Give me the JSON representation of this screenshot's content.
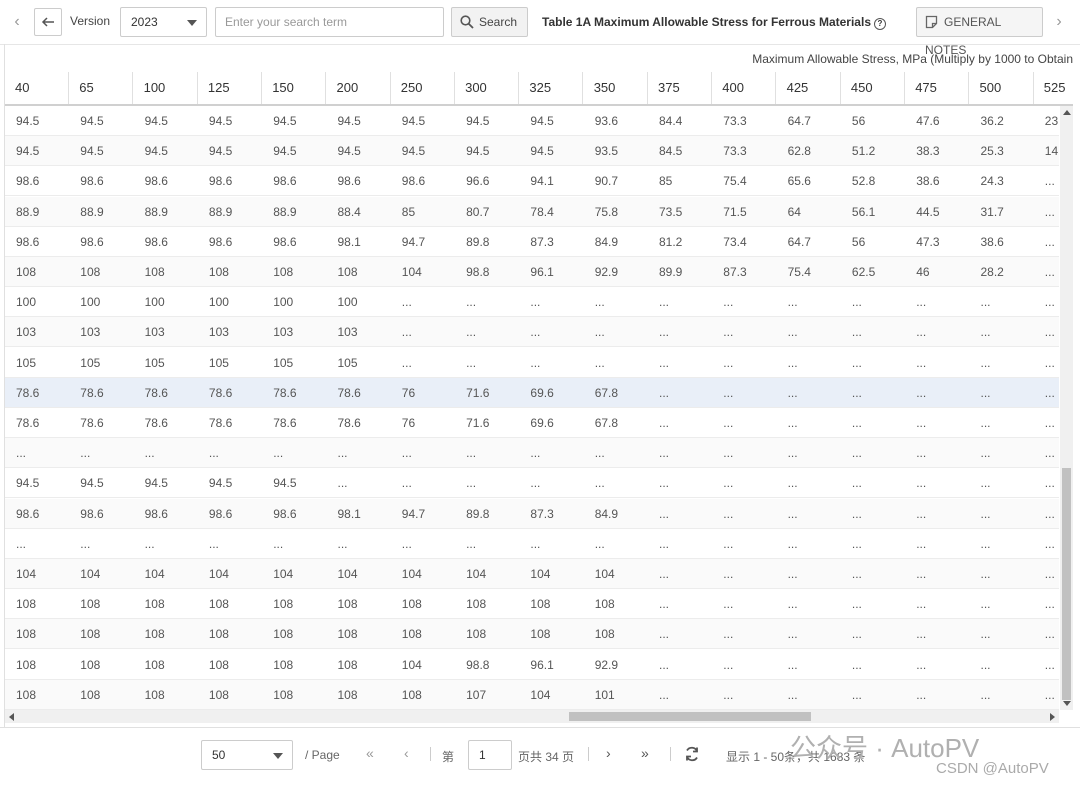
{
  "toolbar": {
    "prev_icon": "chevron-left-icon",
    "back_icon": "arrow-left-icon",
    "version_label": "Version",
    "version_value": "2023",
    "search_placeholder": "Enter your search term",
    "search_label": "Search",
    "table_title": "Table 1A Maximum Allowable Stress for Ferrous Materials",
    "help_glyph": "?",
    "notes_label": "GENERAL NOTES",
    "next_icon": "chevron-right-icon"
  },
  "grid": {
    "caption": "Maximum Allowable Stress, MPa (Multiply by 1000 to Obtain",
    "columns": [
      "40",
      "65",
      "100",
      "125",
      "150",
      "200",
      "250",
      "300",
      "325",
      "350",
      "375",
      "400",
      "425",
      "450",
      "475",
      "500",
      "525"
    ],
    "rows": [
      [
        "94.5",
        "94.5",
        "94.5",
        "94.5",
        "94.5",
        "94.5",
        "94.5",
        "94.5",
        "94.5",
        "93.6",
        "84.4",
        "73.3",
        "64.7",
        "56",
        "47.6",
        "36.2",
        "23"
      ],
      [
        "94.5",
        "94.5",
        "94.5",
        "94.5",
        "94.5",
        "94.5",
        "94.5",
        "94.5",
        "94.5",
        "93.5",
        "84.5",
        "73.3",
        "62.8",
        "51.2",
        "38.3",
        "25.3",
        "14"
      ],
      [
        "98.6",
        "98.6",
        "98.6",
        "98.6",
        "98.6",
        "98.6",
        "98.6",
        "96.6",
        "94.1",
        "90.7",
        "85",
        "75.4",
        "65.6",
        "52.8",
        "38.6",
        "24.3",
        "..."
      ],
      [
        "88.9",
        "88.9",
        "88.9",
        "88.9",
        "88.9",
        "88.4",
        "85",
        "80.7",
        "78.4",
        "75.8",
        "73.5",
        "71.5",
        "64",
        "56.1",
        "44.5",
        "31.7",
        "..."
      ],
      [
        "98.6",
        "98.6",
        "98.6",
        "98.6",
        "98.6",
        "98.1",
        "94.7",
        "89.8",
        "87.3",
        "84.9",
        "81.2",
        "73.4",
        "64.7",
        "56",
        "47.3",
        "38.6",
        "..."
      ],
      [
        "108",
        "108",
        "108",
        "108",
        "108",
        "108",
        "104",
        "98.8",
        "96.1",
        "92.9",
        "89.9",
        "87.3",
        "75.4",
        "62.5",
        "46",
        "28.2",
        "..."
      ],
      [
        "100",
        "100",
        "100",
        "100",
        "100",
        "100",
        "...",
        "...",
        "...",
        "...",
        "...",
        "...",
        "...",
        "...",
        "...",
        "...",
        "..."
      ],
      [
        "103",
        "103",
        "103",
        "103",
        "103",
        "103",
        "...",
        "...",
        "...",
        "...",
        "...",
        "...",
        "...",
        "...",
        "...",
        "...",
        "..."
      ],
      [
        "105",
        "105",
        "105",
        "105",
        "105",
        "105",
        "...",
        "...",
        "...",
        "...",
        "...",
        "...",
        "...",
        "...",
        "...",
        "...",
        "..."
      ],
      [
        "78.6",
        "78.6",
        "78.6",
        "78.6",
        "78.6",
        "78.6",
        "76",
        "71.6",
        "69.6",
        "67.8",
        "...",
        "...",
        "...",
        "...",
        "...",
        "...",
        "..."
      ],
      [
        "78.6",
        "78.6",
        "78.6",
        "78.6",
        "78.6",
        "78.6",
        "76",
        "71.6",
        "69.6",
        "67.8",
        "...",
        "...",
        "...",
        "...",
        "...",
        "...",
        "..."
      ],
      [
        "...",
        "...",
        "...",
        "...",
        "...",
        "...",
        "...",
        "...",
        "...",
        "...",
        "...",
        "...",
        "...",
        "...",
        "...",
        "...",
        "..."
      ],
      [
        "94.5",
        "94.5",
        "94.5",
        "94.5",
        "94.5",
        "...",
        "...",
        "...",
        "...",
        "...",
        "...",
        "...",
        "...",
        "...",
        "...",
        "...",
        "..."
      ],
      [
        "98.6",
        "98.6",
        "98.6",
        "98.6",
        "98.6",
        "98.1",
        "94.7",
        "89.8",
        "87.3",
        "84.9",
        "...",
        "...",
        "...",
        "...",
        "...",
        "...",
        "..."
      ],
      [
        "...",
        "...",
        "...",
        "...",
        "...",
        "...",
        "...",
        "...",
        "...",
        "...",
        "...",
        "...",
        "...",
        "...",
        "...",
        "...",
        "..."
      ],
      [
        "104",
        "104",
        "104",
        "104",
        "104",
        "104",
        "104",
        "104",
        "104",
        "104",
        "...",
        "...",
        "...",
        "...",
        "...",
        "...",
        "..."
      ],
      [
        "108",
        "108",
        "108",
        "108",
        "108",
        "108",
        "108",
        "108",
        "108",
        "108",
        "...",
        "...",
        "...",
        "...",
        "...",
        "...",
        "..."
      ],
      [
        "108",
        "108",
        "108",
        "108",
        "108",
        "108",
        "108",
        "108",
        "108",
        "108",
        "...",
        "...",
        "...",
        "...",
        "...",
        "...",
        "..."
      ],
      [
        "108",
        "108",
        "108",
        "108",
        "108",
        "108",
        "104",
        "98.8",
        "96.1",
        "92.9",
        "...",
        "...",
        "...",
        "...",
        "...",
        "...",
        "..."
      ],
      [
        "108",
        "108",
        "108",
        "108",
        "108",
        "108",
        "108",
        "107",
        "104",
        "101",
        "...",
        "...",
        "...",
        "...",
        "...",
        "...",
        "..."
      ]
    ],
    "selected_row": 9
  },
  "pager": {
    "page_size": "50",
    "per_page_label": "/ Page",
    "first_icon": "double-chevron-left-icon",
    "prev_icon": "chevron-left-icon",
    "page_prefix": "第",
    "page_value": "1",
    "page_suffix": "页共 34 页",
    "next_icon": "chevron-right-icon",
    "last_icon": "double-chevron-right-icon",
    "refresh_icon": "refresh-icon",
    "summary": "显示 1 - 50条，共 1683 条"
  },
  "watermark": {
    "brand": "公众号 · AutoPV",
    "csdn": "CSDN @AutoPV"
  },
  "colors": {
    "selected_row": "#e9eff8",
    "border": "#e0e0e0"
  }
}
